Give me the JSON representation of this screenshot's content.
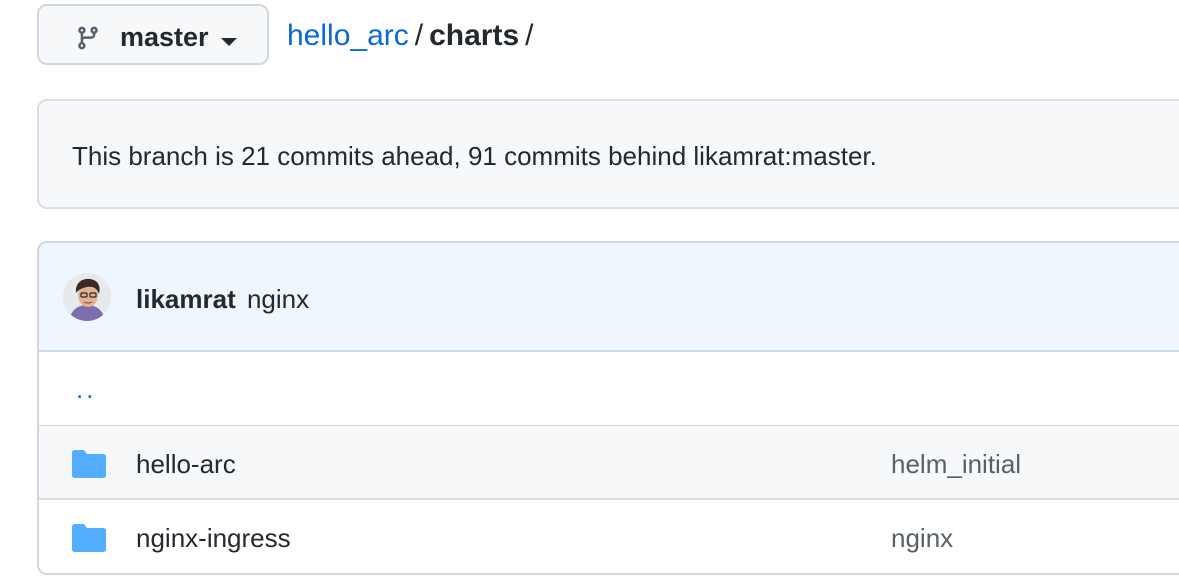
{
  "branch": {
    "name": "master"
  },
  "breadcrumb": {
    "repo": "hello_arc",
    "sep1": "/",
    "folder": "charts",
    "sep2": "/"
  },
  "branch_info": {
    "text": "This branch is 21 commits ahead, 91 commits behind likamrat:master."
  },
  "latest_commit": {
    "author": "likamrat",
    "message": "nginx"
  },
  "parent_dir": {
    "label": ".."
  },
  "files": [
    {
      "name": "hello-arc",
      "commit": "helm_initial",
      "icon": "folder-icon"
    },
    {
      "name": "nginx-ingress",
      "commit": "nginx",
      "icon": "folder-icon"
    }
  ],
  "colors": {
    "link": "#0969da",
    "folder": "#54aeff",
    "header_bg": "#eff6fe"
  }
}
